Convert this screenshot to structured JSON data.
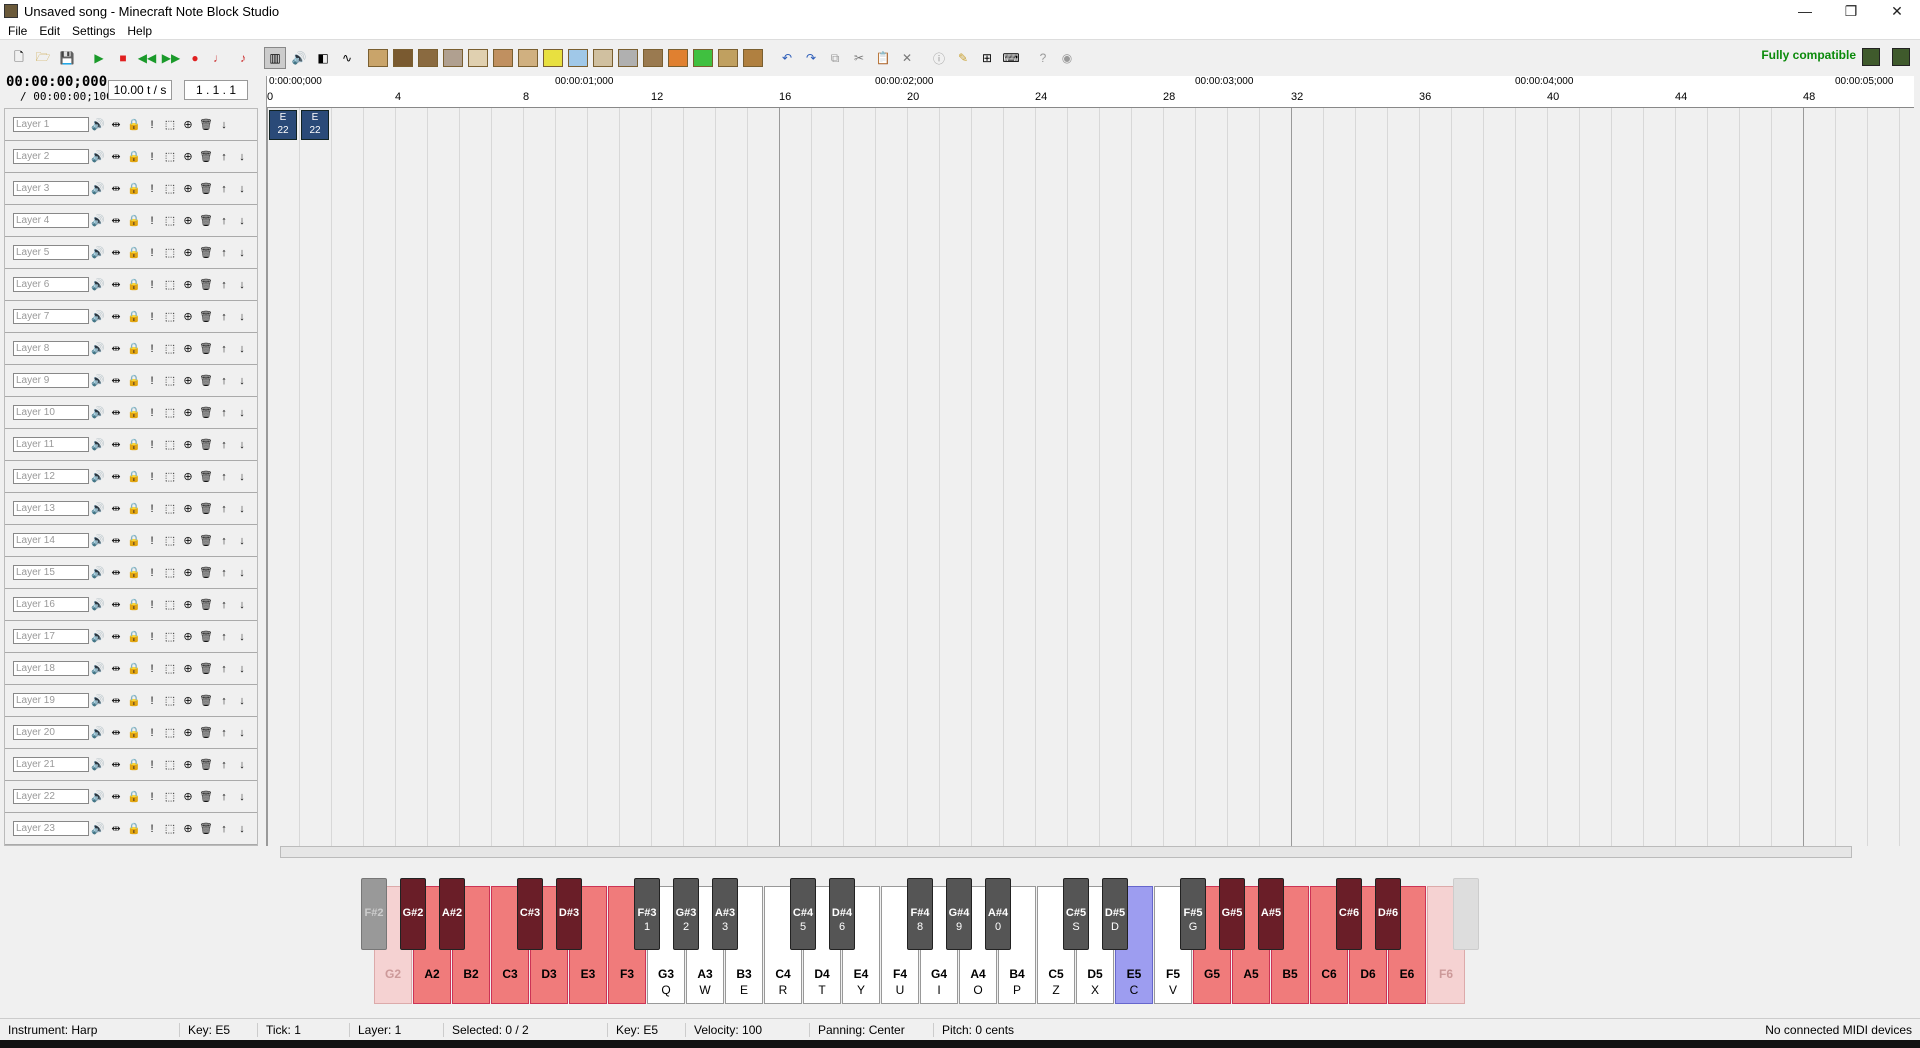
{
  "window": {
    "title": "Unsaved song - Minecraft Note Block Studio",
    "controls": [
      "—",
      "❐",
      "✕"
    ]
  },
  "menu": [
    "File",
    "Edit",
    "Settings",
    "Help"
  ],
  "toolbar": {
    "compat_label": "Fully compatible"
  },
  "time": {
    "current": "00:00:00;000",
    "total": "/ 00:00:00;100",
    "tempo": "10.00 t / s",
    "position": "1 . 1 . 1"
  },
  "ruler": {
    "times": [
      "0:00:00;000",
      "00:00:01;000",
      "00:00:02;000",
      "00:00:03;000",
      "00:00:04;000",
      "00:00:05;000"
    ],
    "beats": [
      "0",
      "4",
      "8",
      "12",
      "16",
      "20",
      "24",
      "28",
      "32",
      "36",
      "40",
      "44",
      "48"
    ]
  },
  "layers": [
    "Layer 1",
    "Layer 2",
    "Layer 3",
    "Layer 4",
    "Layer 5",
    "Layer 6",
    "Layer 7",
    "Layer 8",
    "Layer 9",
    "Layer 10",
    "Layer 11",
    "Layer 12",
    "Layer 13",
    "Layer 14",
    "Layer 15",
    "Layer 16",
    "Layer 17",
    "Layer 18",
    "Layer 19",
    "Layer 20",
    "Layer 21",
    "Layer 22",
    "Layer 23"
  ],
  "notes": [
    {
      "tick": 0,
      "key": "E",
      "value": "22"
    },
    {
      "tick": 1,
      "key": "E",
      "value": "22"
    }
  ],
  "piano": {
    "white": [
      {
        "n": "G2",
        "k": "",
        "s": "pale"
      },
      {
        "n": "A2",
        "k": "",
        "s": "red"
      },
      {
        "n": "B2",
        "k": "",
        "s": "red"
      },
      {
        "n": "C3",
        "k": "",
        "s": "red"
      },
      {
        "n": "D3",
        "k": "",
        "s": "red"
      },
      {
        "n": "E3",
        "k": "",
        "s": "red"
      },
      {
        "n": "F3",
        "k": "",
        "s": "red"
      },
      {
        "n": "G3",
        "k": "Q",
        "s": ""
      },
      {
        "n": "A3",
        "k": "W",
        "s": ""
      },
      {
        "n": "B3",
        "k": "E",
        "s": ""
      },
      {
        "n": "C4",
        "k": "R",
        "s": ""
      },
      {
        "n": "D4",
        "k": "T",
        "s": ""
      },
      {
        "n": "E4",
        "k": "Y",
        "s": ""
      },
      {
        "n": "F4",
        "k": "U",
        "s": ""
      },
      {
        "n": "G4",
        "k": "I",
        "s": ""
      },
      {
        "n": "A4",
        "k": "O",
        "s": ""
      },
      {
        "n": "B4",
        "k": "P",
        "s": ""
      },
      {
        "n": "C5",
        "k": "Z",
        "s": ""
      },
      {
        "n": "D5",
        "k": "X",
        "s": ""
      },
      {
        "n": "E5",
        "k": "C",
        "s": "sel"
      },
      {
        "n": "F5",
        "k": "V",
        "s": ""
      },
      {
        "n": "G5",
        "k": "",
        "s": "red"
      },
      {
        "n": "A5",
        "k": "",
        "s": "red"
      },
      {
        "n": "B5",
        "k": "",
        "s": "red"
      },
      {
        "n": "C6",
        "k": "",
        "s": "red"
      },
      {
        "n": "D6",
        "k": "",
        "s": "red"
      },
      {
        "n": "E6",
        "k": "",
        "s": "red"
      },
      {
        "n": "F6",
        "k": "",
        "s": "pale"
      }
    ],
    "black": [
      {
        "n": "F#2",
        "k": "",
        "s": "pale",
        "after": -1
      },
      {
        "n": "G#2",
        "k": "",
        "s": "red",
        "after": 0
      },
      {
        "n": "A#2",
        "k": "",
        "s": "red",
        "after": 1
      },
      {
        "n": "C#3",
        "k": "",
        "s": "red",
        "after": 3
      },
      {
        "n": "D#3",
        "k": "",
        "s": "red",
        "after": 4
      },
      {
        "n": "F#3",
        "k": "1",
        "s": "",
        "after": 6
      },
      {
        "n": "G#3",
        "k": "2",
        "s": "",
        "after": 7
      },
      {
        "n": "A#3",
        "k": "3",
        "s": "",
        "after": 8
      },
      {
        "n": "C#4",
        "k": "5",
        "s": "",
        "after": 10
      },
      {
        "n": "D#4",
        "k": "6",
        "s": "",
        "after": 11
      },
      {
        "n": "F#4",
        "k": "8",
        "s": "",
        "after": 13
      },
      {
        "n": "G#4",
        "k": "9",
        "s": "",
        "after": 14
      },
      {
        "n": "A#4",
        "k": "0",
        "s": "",
        "after": 15
      },
      {
        "n": "C#5",
        "k": "S",
        "s": "",
        "after": 17
      },
      {
        "n": "D#5",
        "k": "D",
        "s": "",
        "after": 18
      },
      {
        "n": "F#5",
        "k": "G",
        "s": "",
        "after": 20
      },
      {
        "n": "G#5",
        "k": "",
        "s": "red",
        "after": 21
      },
      {
        "n": "A#5",
        "k": "",
        "s": "red",
        "after": 22
      },
      {
        "n": "C#6",
        "k": "",
        "s": "red",
        "after": 24
      },
      {
        "n": "D#6",
        "k": "",
        "s": "red",
        "after": 25
      },
      {
        "n": "",
        "k": "",
        "s": "ghost",
        "after": 27
      }
    ]
  },
  "status": {
    "instrument": "Instrument: Harp",
    "key": "Key: E5",
    "tick": "Tick: 1",
    "layer": "Layer: 1",
    "selected": "Selected: 0 / 2",
    "key2": "Key: E5",
    "velocity": "Velocity: 100",
    "panning": "Panning: Center",
    "pitch": "Pitch: 0 cents",
    "midi": "No connected MIDI devices"
  }
}
